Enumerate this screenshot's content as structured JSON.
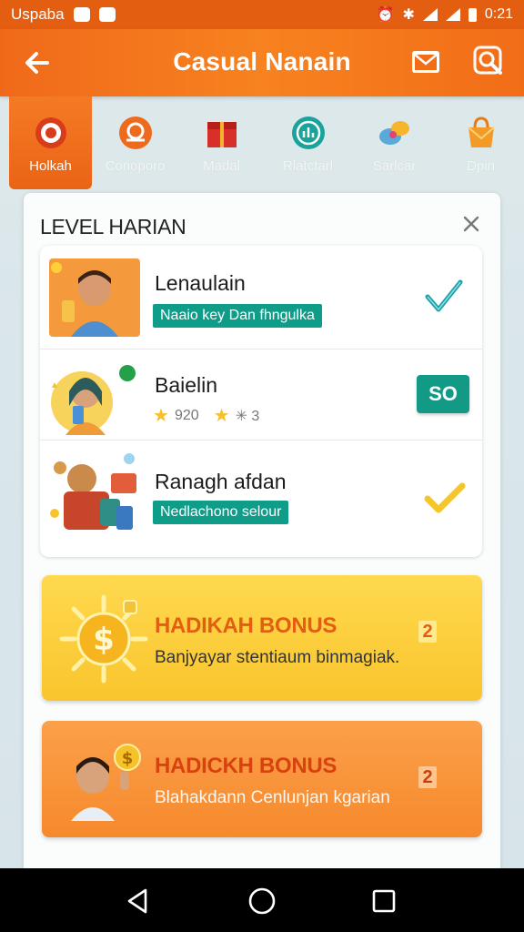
{
  "status_bar": {
    "carrier": "Uspaba",
    "time": "0:21"
  },
  "app_bar": {
    "title": "Casual Nanain"
  },
  "tabs": [
    {
      "label": "Holkah",
      "icon": "target-icon",
      "active": true
    },
    {
      "label": "Conoporo",
      "icon": "hand-coin-icon",
      "active": false
    },
    {
      "label": "Madal",
      "icon": "gift-box-icon",
      "active": false
    },
    {
      "label": "Rlatctarl",
      "icon": "chart-badge-icon",
      "active": false
    },
    {
      "label": "Sarlcar",
      "icon": "chat-bubbles-icon",
      "active": false
    },
    {
      "label": "Dpin",
      "icon": "shopping-bag-icon",
      "active": false
    }
  ],
  "panel": {
    "title": "LEVEL HARIAN",
    "levels": [
      {
        "name": "Lenaulain",
        "tag": "Naaio key Dan fhngulka",
        "status": "done"
      },
      {
        "name": "Baielin",
        "stars": [
          "920",
          "✳ 3"
        ],
        "action": "SO"
      },
      {
        "name": "Ranagh afdan",
        "tag": "Nedlachono selour",
        "status": "done"
      }
    ]
  },
  "bonuses": [
    {
      "title": "HADIKAH BONUS",
      "desc": "Banjyayar stentiaum binmagiak.",
      "count": "2"
    },
    {
      "title": "HADICKH BONUS",
      "desc": "Blahakdann Cenlunjan kgarian",
      "count": "2"
    }
  ],
  "colors": {
    "primary": "#f26d17",
    "accent": "#0f9d8a",
    "bonus_yellow": "#fcd03f",
    "bonus_orange": "#f78f33"
  }
}
